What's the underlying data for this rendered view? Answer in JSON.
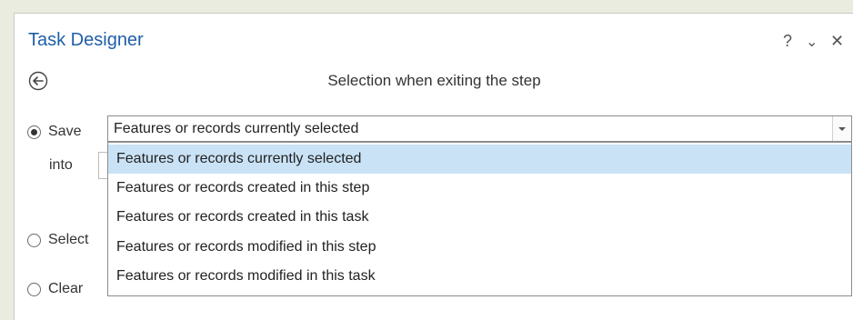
{
  "window": {
    "title": "Task Designer",
    "help_label": "?",
    "menu_label": "⌄",
    "close_label": "✕"
  },
  "header": {
    "subtitle": "Selection when exiting the step"
  },
  "options": {
    "save_label": "Save",
    "into_label": "into",
    "select_label": "Select",
    "clear_label": "Clear"
  },
  "combo": {
    "value": "Features or records currently selected"
  },
  "dropdown": {
    "items": [
      "Features or records currently selected",
      "Features or records created in this step",
      "Features or records created in this task",
      "Features or records modified in this step",
      "Features or records modified in this task"
    ],
    "selected_index": 0
  },
  "colors": {
    "title": "#1f5fa8",
    "highlight": "#c9e2f6",
    "background": "#e9ecdf"
  }
}
